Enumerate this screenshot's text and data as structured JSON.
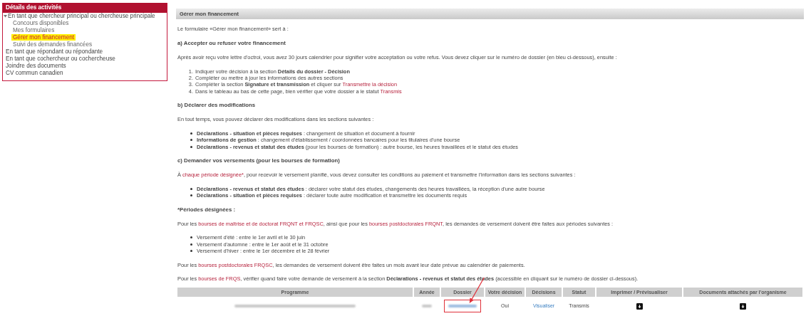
{
  "sidebar": {
    "title": "Détails des activités",
    "items": [
      {
        "label": "En tant que chercheur principal ou chercheuse principale",
        "expanded": true,
        "selected": false,
        "children": [
          {
            "label": "Concours disponibles",
            "selected": false
          },
          {
            "label": "Mes formulaires",
            "selected": false
          },
          {
            "label": "Gérer mon financement",
            "selected": true
          },
          {
            "label": "Suivi des demandes financées",
            "selected": false
          }
        ]
      },
      {
        "label": "En tant que répondant ou répondante",
        "selected": false
      },
      {
        "label": "En tant que cochercheur ou cochercheuse",
        "selected": false
      },
      {
        "label": "Joindre des documents",
        "selected": false
      },
      {
        "label": "CV commun canadien",
        "selected": false
      }
    ]
  },
  "main": {
    "header": "Gérer mon financement",
    "blocks": [
      {
        "kind": "paragraph",
        "segments": [
          {
            "kind": "plain",
            "text": "Le formulaire «Gérer mon financement» sert à :"
          }
        ]
      },
      {
        "kind": "heading",
        "text": "a) Accepter ou refuser votre financement"
      },
      {
        "kind": "paragraph",
        "segments": [
          {
            "kind": "plain",
            "text": "Après avoir reçu votre lettre d'octroi, vous avez 30 jours calendrier pour signifier votre acceptation ou votre refus. Vous devez cliquer sur le numéro de dossier (en bleu ci-dessous), ensuite :"
          }
        ]
      },
      {
        "kind": "ordered",
        "items": [
          {
            "number": "1.",
            "segments": [
              {
                "kind": "plain",
                "text": "Indiquer votre décision à la section "
              },
              {
                "kind": "bold",
                "text": "Détails du dossier - Décision"
              }
            ]
          },
          {
            "number": "2.",
            "segments": [
              {
                "kind": "plain",
                "text": "Compléter ou mettre à jour les informations des autres sections"
              }
            ]
          },
          {
            "number": "3.",
            "segments": [
              {
                "kind": "plain",
                "text": "Compléter la section "
              },
              {
                "kind": "bold",
                "text": "Signature et transmission"
              },
              {
                "kind": "plain",
                "text": " et cliquer sur "
              },
              {
                "kind": "link",
                "text": "Transmettre la décision"
              }
            ]
          },
          {
            "number": "4.",
            "segments": [
              {
                "kind": "plain",
                "text": "Dans le tableau au bas de cette page, bien vérifier que votre dossier a le statut "
              },
              {
                "kind": "link",
                "text": "Transmis"
              }
            ]
          }
        ]
      },
      {
        "kind": "heading",
        "text": "b) Déclarer des modifications"
      },
      {
        "kind": "paragraph",
        "segments": [
          {
            "kind": "plain",
            "text": "En tout temps, vous pouvez déclarer des modifications dans les sections suivantes :"
          }
        ]
      },
      {
        "kind": "bullets",
        "items": [
          {
            "segments": [
              {
                "kind": "bold",
                "text": "Déclarations - situation et pièces requises"
              },
              {
                "kind": "plain",
                "text": " : changement de situation et document à fournir"
              }
            ]
          },
          {
            "segments": [
              {
                "kind": "bold",
                "text": "Informations de gestion"
              },
              {
                "kind": "plain",
                "text": " : changement d'établissement / coordonnées bancaires pour les titulaires d'une bourse"
              }
            ]
          },
          {
            "segments": [
              {
                "kind": "bold",
                "text": "Déclarations - revenus et statut des études"
              },
              {
                "kind": "plain",
                "text": " (pour les bourses de formation) : autre bourse, les heures travaillées et le statut des études"
              }
            ]
          }
        ]
      },
      {
        "kind": "heading",
        "text": "c) Demander vos versements (pour les bourses de formation)"
      },
      {
        "kind": "paragraph",
        "segments": [
          {
            "kind": "plain",
            "text": "À "
          },
          {
            "kind": "link",
            "text": "chaque période désignée*"
          },
          {
            "kind": "plain",
            "text": ", pour recevoir le versement planifié, vous devez consulter les conditions au paiement et transmettre l'information dans les sections suivantes :"
          }
        ]
      },
      {
        "kind": "bullets",
        "items": [
          {
            "segments": [
              {
                "kind": "bold",
                "text": "Déclarations - revenus et statut des études"
              },
              {
                "kind": "plain",
                "text": " : déclarer votre statut des études, changements des heures travaillées, la réception d'une autre bourse"
              }
            ]
          },
          {
            "segments": [
              {
                "kind": "bold",
                "text": "Déclarations - situation et pièces requises"
              },
              {
                "kind": "plain",
                "text": " : déclarer toute autre modification et transmettre les documents requis"
              }
            ]
          }
        ]
      },
      {
        "kind": "heading",
        "text": "*Périodes désignées :"
      },
      {
        "kind": "paragraph",
        "segments": [
          {
            "kind": "plain",
            "text": "Pour les "
          },
          {
            "kind": "link",
            "text": "bourses de maîtrise et de doctorat FRQNT et FRQSC"
          },
          {
            "kind": "plain",
            "text": ", ainsi que pour les "
          },
          {
            "kind": "link",
            "text": "bourses postdoctorales FRQNT"
          },
          {
            "kind": "plain",
            "text": ", les demandes de versement doivent être faites aux périodes suivantes :"
          }
        ]
      },
      {
        "kind": "bullets",
        "items": [
          {
            "segments": [
              {
                "kind": "plain",
                "text": "Versement d'été : entre le 1er avril et le 30 juin"
              }
            ]
          },
          {
            "segments": [
              {
                "kind": "plain",
                "text": "Versement d'automne : entre le 1er août et le 31 octobre"
              }
            ]
          },
          {
            "segments": [
              {
                "kind": "plain",
                "text": "Versement d'hiver : entre le 1er décembre et le 28 février"
              }
            ]
          }
        ]
      },
      {
        "kind": "paragraph",
        "segments": [
          {
            "kind": "plain",
            "text": "Pour les "
          },
          {
            "kind": "link",
            "text": "bourses postdoctorales FRQSC"
          },
          {
            "kind": "plain",
            "text": ", les demandes de versement doivent être faites un mois avant leur date prévue au calendrier de paiements."
          }
        ]
      },
      {
        "kind": "paragraph",
        "segments": [
          {
            "kind": "plain",
            "text": "Pour les "
          },
          {
            "kind": "link",
            "text": "bourses de FRQS"
          },
          {
            "kind": "plain",
            "text": ", vérifier quand faire votre demande de versement à la section "
          },
          {
            "kind": "bold",
            "text": "Déclarations - revenus et statut des études"
          },
          {
            "kind": "plain",
            "text": " (accessible en cliquant sur le numéro de dossier ci-dessous)."
          }
        ]
      }
    ]
  },
  "table": {
    "columns": [
      "Programme",
      "Année",
      "Dossier",
      "Votre décision",
      "Décisions",
      "Statut",
      "Imprimer / Prévisualiser",
      "Documents attachés par l'organisme"
    ],
    "rows": [
      {
        "cells": [
          {
            "kind": "redacted"
          },
          {
            "kind": "redacted"
          },
          {
            "kind": "redacted-link",
            "highlighted": true
          },
          {
            "kind": "text",
            "text": "Oui"
          },
          {
            "kind": "link",
            "text": "Visualiser"
          },
          {
            "kind": "text",
            "text": "Transmis"
          },
          {
            "kind": "icon"
          },
          {
            "kind": "icon"
          }
        ]
      }
    ]
  }
}
